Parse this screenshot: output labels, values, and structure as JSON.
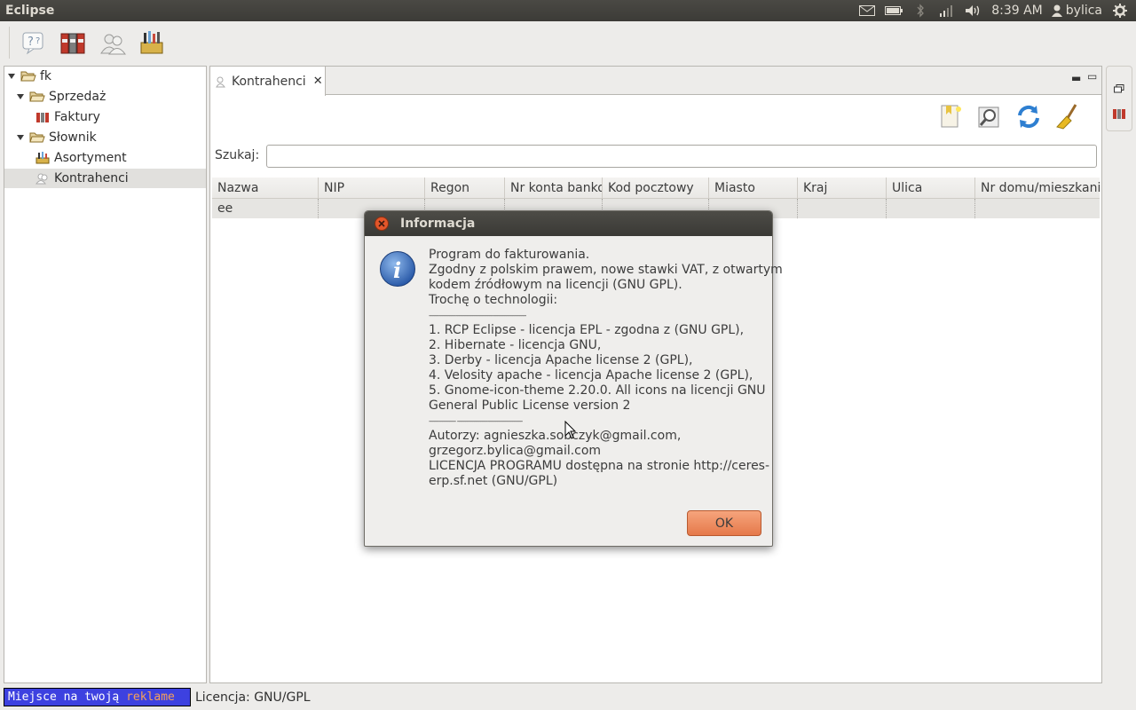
{
  "topbar": {
    "title": "Eclipse",
    "time": "8:39 AM",
    "user": "bylica",
    "icons": [
      "mail-icon",
      "battery-icon",
      "bluetooth-icon",
      "network-icon",
      "volume-icon",
      "user-icon",
      "settings-icon"
    ]
  },
  "toolbar": {
    "buttons": [
      "help-icon",
      "binders-icon",
      "users-icon",
      "toolbox-icon"
    ]
  },
  "tree": {
    "items": [
      {
        "label": "fk",
        "icon": "folder-open-icon"
      },
      {
        "label": "Sprzedaż",
        "icon": "folder-open-icon"
      },
      {
        "label": "Faktury",
        "icon": "binders-icon"
      },
      {
        "label": "Słownik",
        "icon": "folder-open-icon"
      },
      {
        "label": "Asortyment",
        "icon": "toolbox-icon"
      },
      {
        "label": "Kontrahenci",
        "icon": "users-icon"
      }
    ]
  },
  "editor": {
    "tab_label": "Kontrahenci",
    "tools": [
      "new-bookmark-icon",
      "search-icon",
      "refresh-icon",
      "clear-icon"
    ],
    "search_label": "Szukaj:",
    "search_value": "",
    "columns": [
      "Nazwa",
      "NIP",
      "Regon",
      "Nr konta bankowego",
      "Kod pocztowy",
      "Miasto",
      "Kraj",
      "Ulica",
      "Nr domu/mieszkania"
    ],
    "rows": [
      [
        "ee",
        "",
        "",
        "",
        "",
        "",
        "",
        "",
        ""
      ]
    ]
  },
  "dialog": {
    "title": "Informacja",
    "lines": [
      "Program do fakturowania.",
      "Zgodny z polskim prawem, nowe stawki VAT, z otwartym",
      "kodem źródłowym na licencji (GNU GPL).",
      "Trochę o technologii:",
      "----------------------------------------------------------",
      "1. RCP Eclipse - licencja EPL - zgodna z (GNU GPL),",
      "2. Hibernate - licencja GNU,",
      "3. Derby - licencja Apache license 2 (GPL),",
      "4. Velosity apache - licencja Apache license 2 (GPL),",
      "5. Gnome-icon-theme 2.20.0. All icons na licencji GNU",
      "General Public License version 2",
      "---------------- ---------------------------------------",
      "Autorzy: agnieszka.sobczyk@gmail.com,",
      "grzegorz.bylica@gmail.com",
      "LICENCJA PROGRAMU dostępna na stronie http://ceres-",
      "erp.sf.net (GNU/GPL)"
    ],
    "ok_label": "OK"
  },
  "status": {
    "ad_prefix": "Miejsce na twoją ",
    "ad_highlight": "reklame",
    "license": "Licencja: GNU/GPL"
  },
  "colors": {
    "panel": "#3c3b37",
    "accent_button": "#e5794a",
    "ad_background": "#3d41e0"
  }
}
